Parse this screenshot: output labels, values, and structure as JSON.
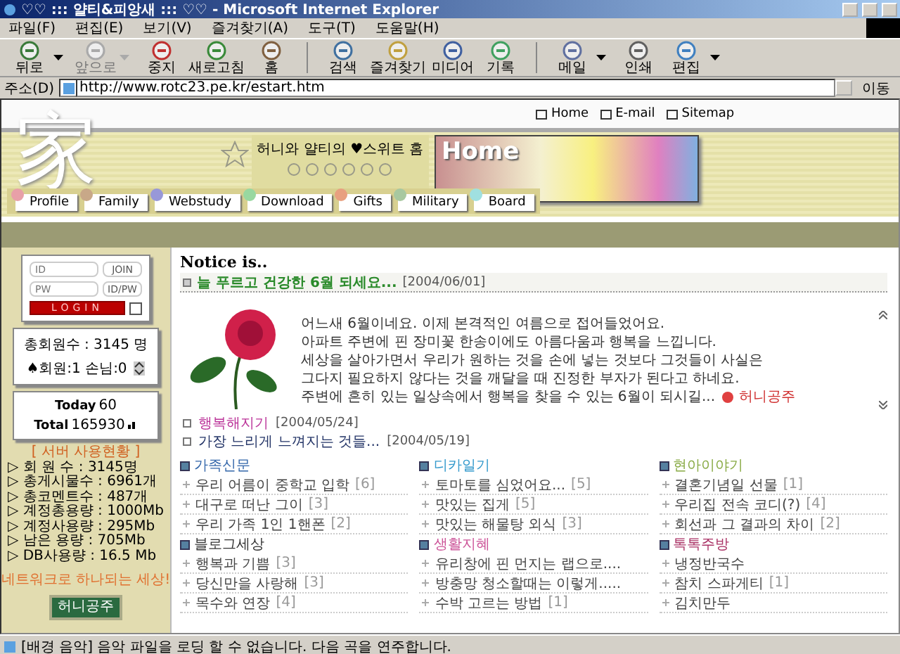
{
  "window": {
    "title": "♡♡ ::: 얄티&피앙새 ::: ♡♡ - Microsoft Internet Explorer"
  },
  "menu": [
    "파일(F)",
    "편집(E)",
    "보기(V)",
    "즐겨찾기(A)",
    "도구(T)",
    "도움말(H)"
  ],
  "toolbar": [
    {
      "label": "뒤로",
      "disabled": false,
      "dropdown": true
    },
    {
      "label": "앞으로",
      "disabled": true,
      "dropdown": true
    },
    {
      "label": "중지",
      "disabled": false,
      "dropdown": false
    },
    {
      "label": "새로고침",
      "disabled": false,
      "dropdown": false
    },
    {
      "label": "홈",
      "disabled": false,
      "dropdown": false
    },
    {
      "label": "검색",
      "disabled": false,
      "dropdown": false
    },
    {
      "label": "즐겨찾기",
      "disabled": false,
      "dropdown": false
    },
    {
      "label": "미디어",
      "disabled": false,
      "dropdown": false
    },
    {
      "label": "기록",
      "disabled": false,
      "dropdown": false
    },
    {
      "label": "메일",
      "disabled": false,
      "dropdown": true
    },
    {
      "label": "인쇄",
      "disabled": false,
      "dropdown": false
    },
    {
      "label": "편집",
      "disabled": false,
      "dropdown": true
    }
  ],
  "address": {
    "label": "주소(D)",
    "value": "http://www.rotc23.pe.kr/estart.htm",
    "go": "이동"
  },
  "site": {
    "top_links": [
      "Home",
      "E-mail",
      "Sitemap"
    ],
    "logo": "家",
    "tagline": "허니와  얄티의 ♥스위트 홈",
    "banner_title": "Home",
    "nav": [
      {
        "label": "Profile",
        "color": "#e8a0a8"
      },
      {
        "label": "Family",
        "color": "#c8a888"
      },
      {
        "label": "Webstudy",
        "color": "#9898d8"
      },
      {
        "label": "Download",
        "color": "#98d8a0"
      },
      {
        "label": "Gifts",
        "color": "#e8a080"
      },
      {
        "label": "Military",
        "color": "#a8c8a0"
      },
      {
        "label": "Board",
        "color": "#a0e0e0"
      }
    ]
  },
  "sidebar": {
    "login": {
      "id_placeholder": "ID",
      "pw_placeholder": "PW",
      "join": "JOIN",
      "idpw": "ID/PW",
      "login": "LOGIN",
      "remember": false
    },
    "members": {
      "total": "총회원수 : 3145 명",
      "online": "♠회원:1 손님:0"
    },
    "counter": {
      "today_label": "Today",
      "today": "60",
      "total_label": "Total",
      "total": "165930"
    },
    "server": {
      "title": "[ 서버 사용현황 ]",
      "lines": [
        "▷ 회 원 수 : 3145명",
        "▷ 총게시물수 : 6961개",
        "▷ 총코멘트수 : 487개",
        "▷ 계정총용량 : 1000Mb",
        "▷ 계정사용량 : 295Mb",
        "▷ 남은 용량 : 705Mb",
        "▷ DB사용량 : 16.5 Mb"
      ]
    },
    "slogan": "네트워크로 하나되는 세상!",
    "banner_text": "허니공주"
  },
  "notice": {
    "heading": "Notice is..",
    "featured": {
      "title": "늘 푸르고 건강한 6월 되세요...",
      "date": "[2004/06/01]",
      "body": [
        "어느새 6월이네요. 이제 본격적인 여름으로 접어들었어요.",
        "아파트 주변에 핀 장미꽃 한송이에도 아름다움과 행복을 느낍니다.",
        "세상을 살아가면서 우리가 원하는 것을 손에 넣는 것보다 그것들이 사실은",
        "그다지 필요하지 않다는 것을 깨달을 때 진정한 부자가 된다고 하네요.",
        "주변에 흔히 있는 일상속에서 행복을 찾을 수 있는 6월이 되시길..."
      ],
      "author": "허니공주"
    },
    "items": [
      {
        "title": "행복해지기",
        "date": "[2004/05/24]",
        "color": "#bb3399"
      },
      {
        "title": "가장 느리게 느껴지는 것들...",
        "date": "[2004/05/19]",
        "color": "#223366"
      }
    ]
  },
  "boards": [
    {
      "title": "가족신문",
      "color": "#3366aa",
      "posts": [
        {
          "title": "우리 어름이 중학교 입학",
          "count": "[6]"
        },
        {
          "title": "대구로 떠난 그이",
          "count": "[3]"
        },
        {
          "title": "우리 가족 1인 1핸폰",
          "count": "[2]"
        }
      ]
    },
    {
      "title": "디카일기",
      "color": "#3399cc",
      "posts": [
        {
          "title": "토마토를 심었어요...",
          "count": "[5]"
        },
        {
          "title": "맛있는 집게",
          "count": "[5]"
        },
        {
          "title": "맛있는 해물탕 외식",
          "count": "[3]"
        }
      ]
    },
    {
      "title": "현아이야기",
      "color": "#88aa44",
      "posts": [
        {
          "title": "결혼기념일 선물",
          "count": "[1]"
        },
        {
          "title": "우리집 전속 코디(?)",
          "count": "[4]"
        },
        {
          "title": "회선과 그 결과의 차이",
          "count": "[2]"
        }
      ]
    },
    {
      "title": "블로그세상",
      "color": "#333333",
      "posts": [
        {
          "title": "행복과 기쁨",
          "count": "[3]"
        },
        {
          "title": "당신만을 사랑해",
          "count": "[3]"
        },
        {
          "title": "목수와 연장",
          "count": "[4]"
        }
      ]
    },
    {
      "title": "생활지혜",
      "color": "#cc5599",
      "posts": [
        {
          "title": "유리창에 핀 먼지는 랩으로...."
        },
        {
          "title": "방충망 청소할때는 이렇게....."
        },
        {
          "title": "수박 고르는 방법",
          "count": "[1]"
        }
      ]
    },
    {
      "title": "톡톡주방",
      "color": "#aa3366",
      "posts": [
        {
          "title": "냉정반국수"
        },
        {
          "title": "참치 스파게티",
          "count": "[1]"
        },
        {
          "title": "김치만두"
        }
      ]
    }
  ],
  "status_bar": {
    "text": "[배경 음악] 음악 파일을 로딩 할 수 없습니다. 다음 곡을 연주합니다."
  }
}
